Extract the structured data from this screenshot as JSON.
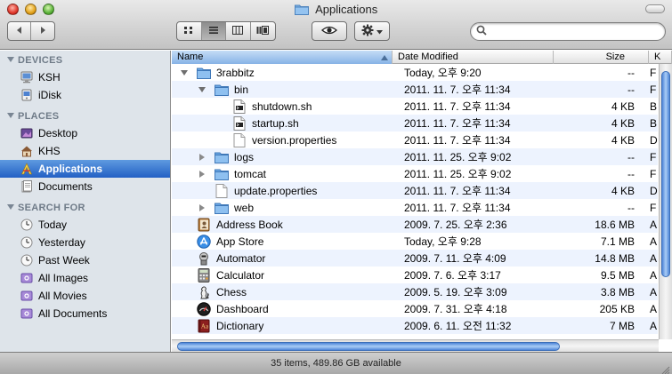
{
  "window": {
    "title": "Applications",
    "status_text": "35 items, 489.86 GB available"
  },
  "toolbar": {
    "back_icon": "back-arrow-icon",
    "forward_icon": "forward-arrow-icon",
    "views": [
      "icon-view",
      "list-view",
      "column-view",
      "coverflow-view"
    ],
    "active_view": "list-view",
    "search_placeholder": ""
  },
  "sidebar": {
    "sections": [
      {
        "title": "DEVICES",
        "items": [
          {
            "label": "KSH",
            "icon": "computer-icon"
          },
          {
            "label": "iDisk",
            "icon": "idisk-icon"
          }
        ]
      },
      {
        "title": "PLACES",
        "items": [
          {
            "label": "Desktop",
            "icon": "desktop-icon"
          },
          {
            "label": "KHS",
            "icon": "home-icon"
          },
          {
            "label": "Applications",
            "icon": "applications-icon",
            "selected": true
          },
          {
            "label": "Documents",
            "icon": "documents-icon"
          }
        ]
      },
      {
        "title": "SEARCH FOR",
        "items": [
          {
            "label": "Today",
            "icon": "clock-icon"
          },
          {
            "label": "Yesterday",
            "icon": "clock-icon"
          },
          {
            "label": "Past Week",
            "icon": "clock-icon"
          },
          {
            "label": "All Images",
            "icon": "smart-folder-icon"
          },
          {
            "label": "All Movies",
            "icon": "smart-folder-icon"
          },
          {
            "label": "All Documents",
            "icon": "smart-folder-icon"
          }
        ]
      }
    ]
  },
  "list": {
    "columns": {
      "name": "Name",
      "date": "Date Modified",
      "size": "Size",
      "kind": "K"
    },
    "rows": [
      {
        "indent": 0,
        "disclosure": "open",
        "icon": "folder-icon",
        "name": "3rabbitz",
        "date": "Today, 오후 9:20",
        "size": "--",
        "kind": "F"
      },
      {
        "indent": 1,
        "disclosure": "open",
        "icon": "folder-icon",
        "name": "bin",
        "date": "2011. 11. 7. 오후 11:34",
        "size": "--",
        "kind": "F"
      },
      {
        "indent": 2,
        "disclosure": "none",
        "icon": "script-file-icon",
        "name": "shutdown.sh",
        "date": "2011. 11. 7. 오후 11:34",
        "size": "4 KB",
        "kind": "B"
      },
      {
        "indent": 2,
        "disclosure": "none",
        "icon": "script-file-icon",
        "name": "startup.sh",
        "date": "2011. 11. 7. 오후 11:34",
        "size": "4 KB",
        "kind": "B"
      },
      {
        "indent": 2,
        "disclosure": "none",
        "icon": "document-icon",
        "name": "version.properties",
        "date": "2011. 11. 7. 오후 11:34",
        "size": "4 KB",
        "kind": "D"
      },
      {
        "indent": 1,
        "disclosure": "closed",
        "icon": "folder-icon",
        "name": "logs",
        "date": "2011. 11. 25. 오후 9:02",
        "size": "--",
        "kind": "F"
      },
      {
        "indent": 1,
        "disclosure": "closed",
        "icon": "folder-icon",
        "name": "tomcat",
        "date": "2011. 11. 25. 오후 9:02",
        "size": "--",
        "kind": "F"
      },
      {
        "indent": 1,
        "disclosure": "none",
        "icon": "document-icon",
        "name": "update.properties",
        "date": "2011. 11. 7. 오후 11:34",
        "size": "4 KB",
        "kind": "D"
      },
      {
        "indent": 1,
        "disclosure": "closed",
        "icon": "folder-icon",
        "name": "web",
        "date": "2011. 11. 7. 오후 11:34",
        "size": "--",
        "kind": "F"
      },
      {
        "indent": 0,
        "disclosure": "none",
        "icon": "address-book-icon",
        "name": "Address Book",
        "date": "2009. 7. 25. 오후 2:36",
        "size": "18.6 MB",
        "kind": "A"
      },
      {
        "indent": 0,
        "disclosure": "none",
        "icon": "app-store-icon",
        "name": "App Store",
        "date": "Today, 오후 9:28",
        "size": "7.1 MB",
        "kind": "A"
      },
      {
        "indent": 0,
        "disclosure": "none",
        "icon": "automator-icon",
        "name": "Automator",
        "date": "2009. 7. 11. 오후 4:09",
        "size": "14.8 MB",
        "kind": "A"
      },
      {
        "indent": 0,
        "disclosure": "none",
        "icon": "calculator-icon",
        "name": "Calculator",
        "date": "2009. 7. 6. 오후 3:17",
        "size": "9.5 MB",
        "kind": "A"
      },
      {
        "indent": 0,
        "disclosure": "none",
        "icon": "chess-icon",
        "name": "Chess",
        "date": "2009. 5. 19. 오후 3:09",
        "size": "3.8 MB",
        "kind": "A"
      },
      {
        "indent": 0,
        "disclosure": "none",
        "icon": "dashboard-icon",
        "name": "Dashboard",
        "date": "2009. 7. 31. 오후 4:18",
        "size": "205 KB",
        "kind": "A"
      },
      {
        "indent": 0,
        "disclosure": "none",
        "icon": "dictionary-icon",
        "name": "Dictionary",
        "date": "2009. 6. 11. 오전 11:32",
        "size": "7 MB",
        "kind": "A"
      }
    ]
  },
  "colors": {
    "selection": "#2360c4",
    "row_alt": "#edf3fe",
    "sidebar_bg": "#dee4ea",
    "folder_blue": "#7db3e8"
  }
}
